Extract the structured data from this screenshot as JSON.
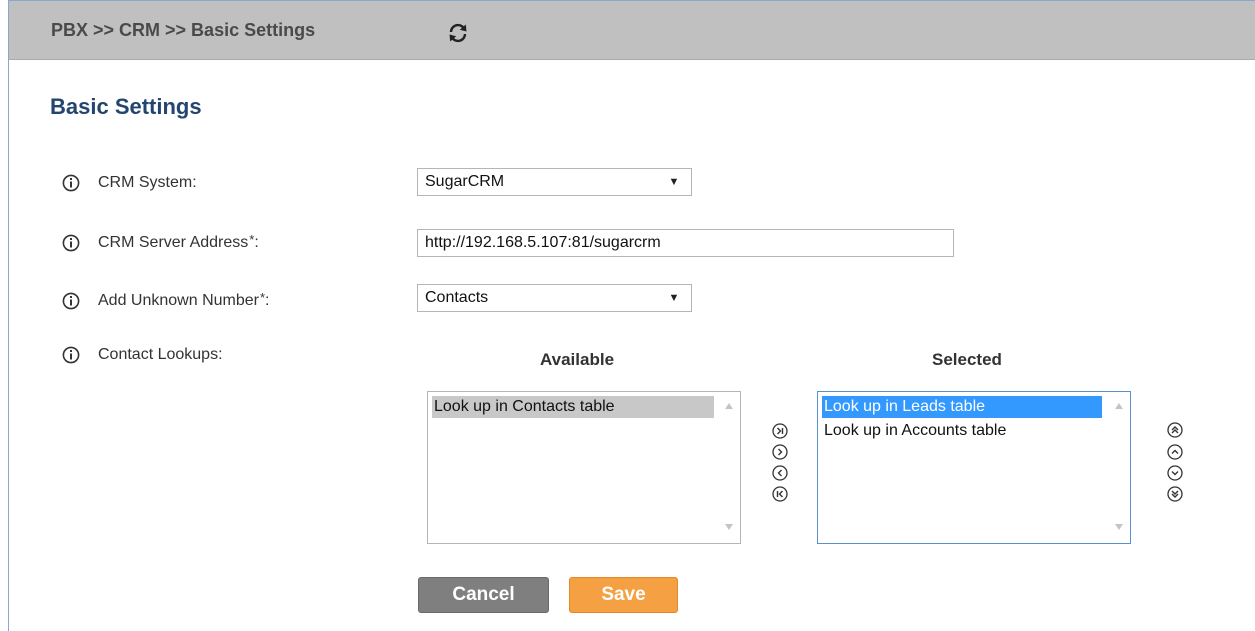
{
  "header": {
    "breadcrumb": "PBX >> CRM >> Basic Settings",
    "refresh_icon": "refresh-icon"
  },
  "page": {
    "title": "Basic Settings"
  },
  "form": {
    "crm_system": {
      "label": "CRM System:",
      "value": "SugarCRM"
    },
    "server_address": {
      "label": "CRM Server Address",
      "required_mark": "*",
      "label_suffix": ":",
      "value": "http://192.168.5.107:81/sugarcrm"
    },
    "unknown_number": {
      "label": "Add Unknown Number",
      "required_mark": "*",
      "label_suffix": ":",
      "value": "Contacts"
    },
    "contact_lookups": {
      "label": "Contact Lookups:"
    }
  },
  "lookups": {
    "available_heading": "Available",
    "selected_heading": "Selected",
    "available_items": [
      "Look up in Contacts table"
    ],
    "selected_items": [
      "Look up in Leads table",
      "Look up in Accounts table"
    ]
  },
  "buttons": {
    "cancel": "Cancel",
    "save": "Save"
  },
  "colors": {
    "accent_title": "#24456e",
    "save_button": "#f5a042",
    "cancel_button": "#7f7f7f",
    "selection_blue": "#3399ff",
    "header_bar": "#c0c0c0"
  }
}
